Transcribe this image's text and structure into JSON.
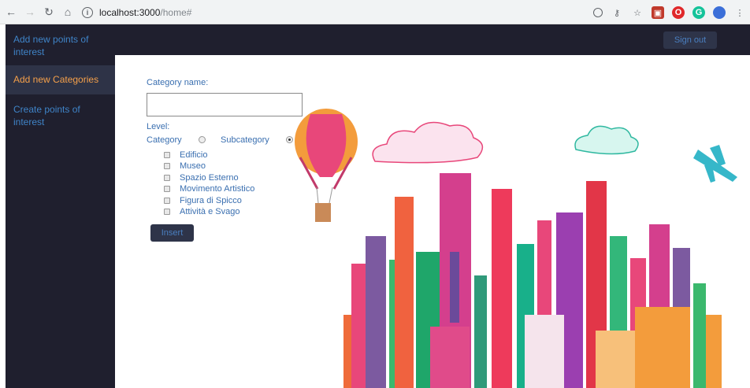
{
  "browser": {
    "url_host": "localhost:3000",
    "url_path": "/home#",
    "nav_icons": [
      "back-arrow-icon",
      "forward-arrow-icon",
      "reload-icon",
      "home-icon"
    ]
  },
  "sidebar": {
    "items": [
      {
        "label": "Add new points of interest"
      },
      {
        "label": "Add new Categories"
      },
      {
        "label": "Create points of interest"
      }
    ]
  },
  "header": {
    "signout_label": "Sign out"
  },
  "form": {
    "category_name_label": "Category name:",
    "category_name_value": "",
    "level_label": "Level:",
    "level_options": [
      "Category",
      "Subcategory"
    ],
    "level_selected": "Subcategory",
    "parent_categories": [
      "Edificio",
      "Museo",
      "Spazio Esterno",
      "Movimento Artistico",
      "Figura di Spicco",
      "Attività e Svago"
    ],
    "insert_label": "Insert"
  },
  "colors": {
    "sidebar_bg": "#1f1f2e",
    "accent_blue": "#3f84c8",
    "active_orange": "#f5a04a"
  }
}
